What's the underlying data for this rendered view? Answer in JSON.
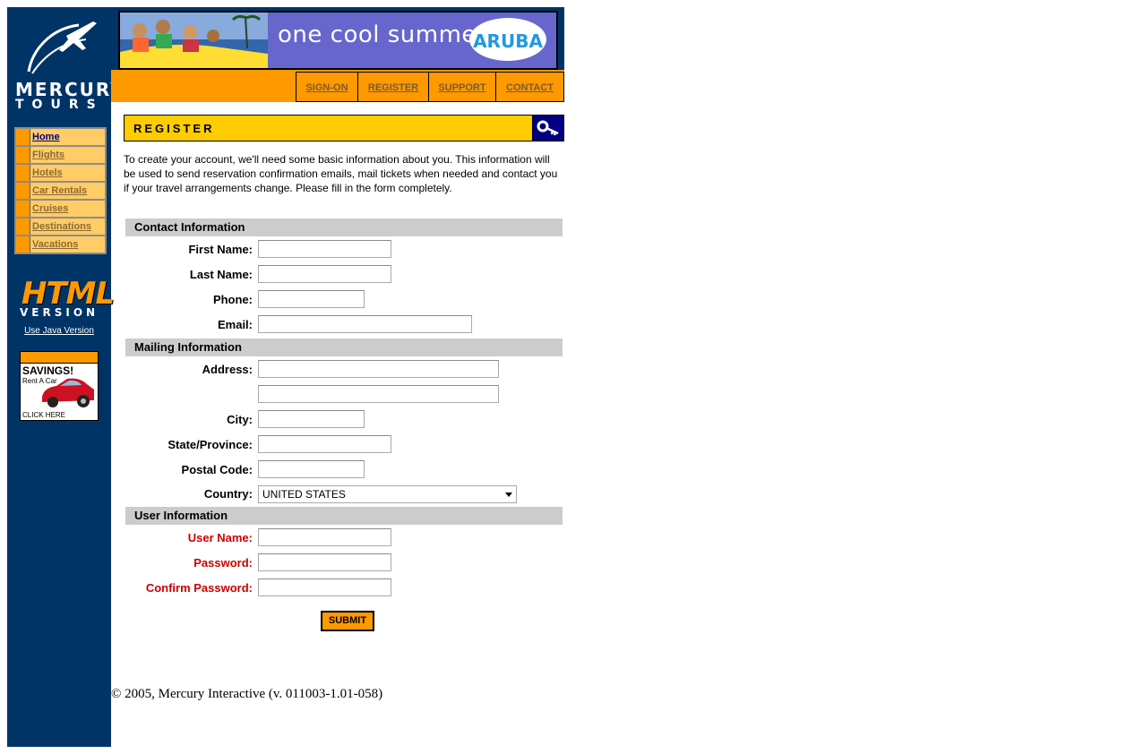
{
  "colors": {
    "navy": "#003366",
    "orange": "#ff9900",
    "yellow": "#ffcc00",
    "menu_item": "#ffcc66",
    "section_gray": "#cccccc",
    "required_red": "#cc0000"
  },
  "brand": {
    "line1": "MERCURY",
    "line2": "TOURS"
  },
  "banner": {
    "text": "one cool summer",
    "logo_text": "ARUBA"
  },
  "topnav": {
    "items": [
      {
        "label": "SIGN-ON"
      },
      {
        "label": "REGISTER"
      },
      {
        "label": "SUPPORT"
      },
      {
        "label": "CONTACT"
      }
    ]
  },
  "sidebar": {
    "items": [
      {
        "label": "Home"
      },
      {
        "label": "Flights"
      },
      {
        "label": "Hotels"
      },
      {
        "label": "Car Rentals"
      },
      {
        "label": "Cruises"
      },
      {
        "label": "Destinations"
      },
      {
        "label": "Vacations"
      }
    ],
    "html_badge": {
      "word": "HTML",
      "sub": "VERSION"
    },
    "java_link": "Use Java Version",
    "ad": {
      "title": "SAVINGS!",
      "line": "Rent A Car",
      "cta": "CLICK HERE"
    }
  },
  "page": {
    "heading": "REGISTER",
    "intro": "To create your account, we'll need some basic information about you. This information will be used to send reservation confirmation emails, mail tickets when needed and contact you if your travel arrangements change. Please fill in the form completely."
  },
  "sections": {
    "contact": "Contact Information",
    "mailing": "Mailing Information",
    "user": "User Information"
  },
  "fields": {
    "first_name": {
      "label": "First Name:",
      "value": ""
    },
    "last_name": {
      "label": "Last Name:",
      "value": ""
    },
    "phone": {
      "label": "Phone:",
      "value": ""
    },
    "email": {
      "label": "Email:",
      "value": ""
    },
    "address": {
      "label": "Address:",
      "value": "",
      "value2": ""
    },
    "city": {
      "label": "City:",
      "value": ""
    },
    "state": {
      "label": "State/Province:",
      "value": ""
    },
    "postal": {
      "label": "Postal Code:",
      "value": ""
    },
    "country": {
      "label": "Country:",
      "selected": "UNITED STATES"
    },
    "username": {
      "label": "User Name:",
      "value": ""
    },
    "password": {
      "label": "Password:",
      "value": ""
    },
    "confirm_password": {
      "label": "Confirm Password:",
      "value": ""
    }
  },
  "submit_label": "SUBMIT",
  "footer": "© 2005, Mercury Interactive (v. 011003-1.01-058)"
}
